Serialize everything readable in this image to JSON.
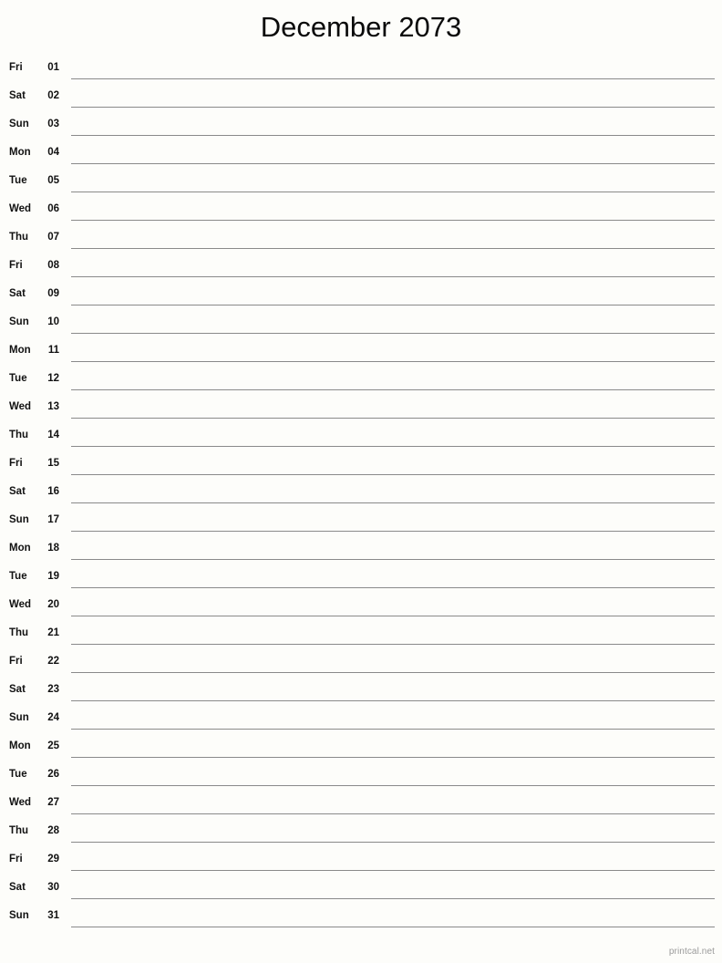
{
  "document": {
    "title": "December 2073",
    "month": "December",
    "year": "2073",
    "layout": "single-column-notes",
    "watermark": "printcal.net",
    "colors": {
      "background": "#fdfdfa",
      "text": "#111111",
      "rule_line": "#8a8a8a",
      "watermark": "#9a9a9a"
    }
  },
  "days": [
    {
      "weekday": "Fri",
      "date": "01"
    },
    {
      "weekday": "Sat",
      "date": "02"
    },
    {
      "weekday": "Sun",
      "date": "03"
    },
    {
      "weekday": "Mon",
      "date": "04"
    },
    {
      "weekday": "Tue",
      "date": "05"
    },
    {
      "weekday": "Wed",
      "date": "06"
    },
    {
      "weekday": "Thu",
      "date": "07"
    },
    {
      "weekday": "Fri",
      "date": "08"
    },
    {
      "weekday": "Sat",
      "date": "09"
    },
    {
      "weekday": "Sun",
      "date": "10"
    },
    {
      "weekday": "Mon",
      "date": "11"
    },
    {
      "weekday": "Tue",
      "date": "12"
    },
    {
      "weekday": "Wed",
      "date": "13"
    },
    {
      "weekday": "Thu",
      "date": "14"
    },
    {
      "weekday": "Fri",
      "date": "15"
    },
    {
      "weekday": "Sat",
      "date": "16"
    },
    {
      "weekday": "Sun",
      "date": "17"
    },
    {
      "weekday": "Mon",
      "date": "18"
    },
    {
      "weekday": "Tue",
      "date": "19"
    },
    {
      "weekday": "Wed",
      "date": "20"
    },
    {
      "weekday": "Thu",
      "date": "21"
    },
    {
      "weekday": "Fri",
      "date": "22"
    },
    {
      "weekday": "Sat",
      "date": "23"
    },
    {
      "weekday": "Sun",
      "date": "24"
    },
    {
      "weekday": "Mon",
      "date": "25"
    },
    {
      "weekday": "Tue",
      "date": "26"
    },
    {
      "weekday": "Wed",
      "date": "27"
    },
    {
      "weekday": "Thu",
      "date": "28"
    },
    {
      "weekday": "Fri",
      "date": "29"
    },
    {
      "weekday": "Sat",
      "date": "30"
    },
    {
      "weekday": "Sun",
      "date": "31"
    }
  ]
}
